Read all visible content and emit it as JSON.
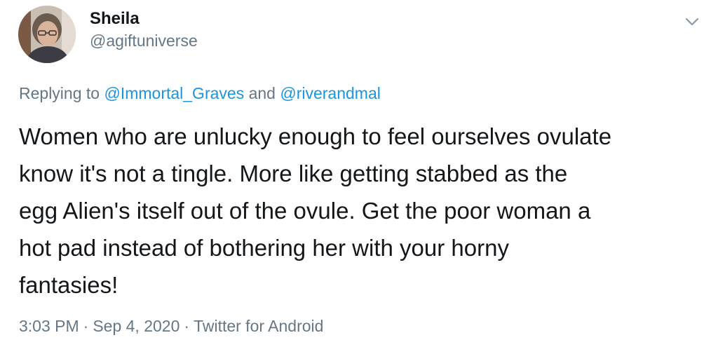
{
  "user": {
    "display_name": "Sheila",
    "handle": "@agiftuniverse"
  },
  "icons": {
    "menu": "chevron-down-icon",
    "avatar": "profile-photo"
  },
  "reply": {
    "prefix": "Replying to",
    "mention_1": "@Immortal_Graves",
    "conjunction": "and",
    "mention_2": "@riverandmal"
  },
  "tweet": {
    "line_1": "Women who are unlucky enough to feel ourselves ovulate",
    "line_2": "know it's not a tingle. More like getting stabbed as the",
    "line_3": "egg Alien's itself out of the ovule. Get the poor woman a",
    "line_4": "hot pad instead of bothering her with your horny",
    "line_5": "fantasies!"
  },
  "meta": {
    "time": "3:03 PM",
    "separator": "·",
    "date": "Sep 4, 2020",
    "source": "Twitter for Android"
  },
  "colors": {
    "text": "#14171a",
    "secondary": "#657786",
    "link": "#1b95e0",
    "background": "#ffffff"
  }
}
